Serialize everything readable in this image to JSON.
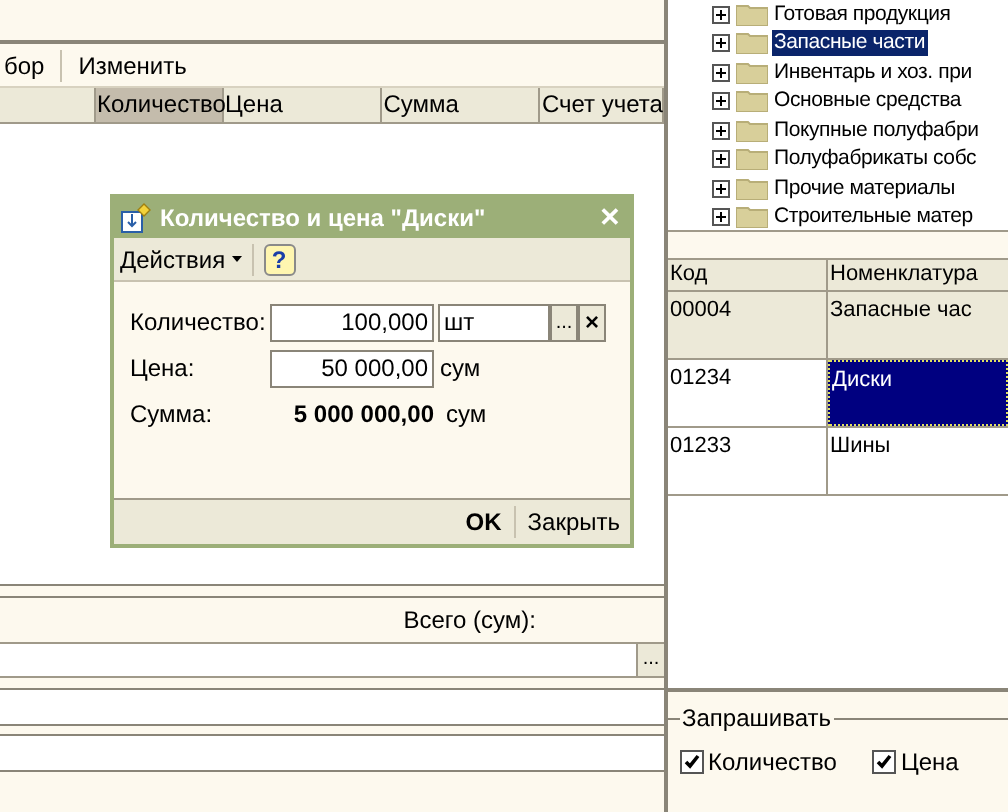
{
  "document": {
    "toolbar": [
      "бор",
      "Изменить"
    ],
    "columns": [
      {
        "label": "Количество",
        "sorted": true
      },
      {
        "label": "Цена",
        "sorted": false
      },
      {
        "label": "Сумма",
        "sorted": false
      },
      {
        "label": "Счет учета",
        "sorted": false
      }
    ],
    "total_label": "Всего (сум):",
    "field_button": "..."
  },
  "tree": {
    "items": [
      {
        "label": "Готовая продукция",
        "selected": false
      },
      {
        "label": "Запасные части",
        "selected": true
      },
      {
        "label": "Инвентарь и хоз. при",
        "selected": false
      },
      {
        "label": "Основные средства",
        "selected": false
      },
      {
        "label": "Покупные полуфабри",
        "selected": false
      },
      {
        "label": "Полуфабрикаты собс",
        "selected": false
      },
      {
        "label": "Прочие материалы",
        "selected": false
      },
      {
        "label": "Строительные матер",
        "selected": false
      }
    ]
  },
  "list": {
    "columns": [
      "Код",
      "Номенклатура"
    ],
    "rows": [
      {
        "code": "00004",
        "name": "Запасные час",
        "kind": "group",
        "selected": false
      },
      {
        "code": "01234",
        "name": "Диски",
        "kind": "item",
        "selected": true
      },
      {
        "code": "01233",
        "name": "Шины",
        "kind": "item",
        "selected": false
      }
    ]
  },
  "ask": {
    "title": "Запрашивать",
    "options": [
      {
        "label": "Количество",
        "checked": true
      },
      {
        "label": "Цена",
        "checked": true
      }
    ]
  },
  "dialog": {
    "title": "Количество и цена \"Диски\"",
    "close": "✕",
    "menu": "Действия",
    "help": "?",
    "quantity": {
      "label": "Количество:",
      "value": "100,000",
      "unit": "шт",
      "buttons": [
        "...",
        "×"
      ]
    },
    "price": {
      "label": "Цена:",
      "value": "50 000,00",
      "currency": "сум"
    },
    "sum": {
      "label": "Сумма:",
      "value": "5 000 000,00",
      "currency": "сум"
    },
    "buttons": [
      {
        "label": "OK",
        "default": true
      },
      {
        "label": "Закрыть",
        "default": false
      }
    ]
  }
}
